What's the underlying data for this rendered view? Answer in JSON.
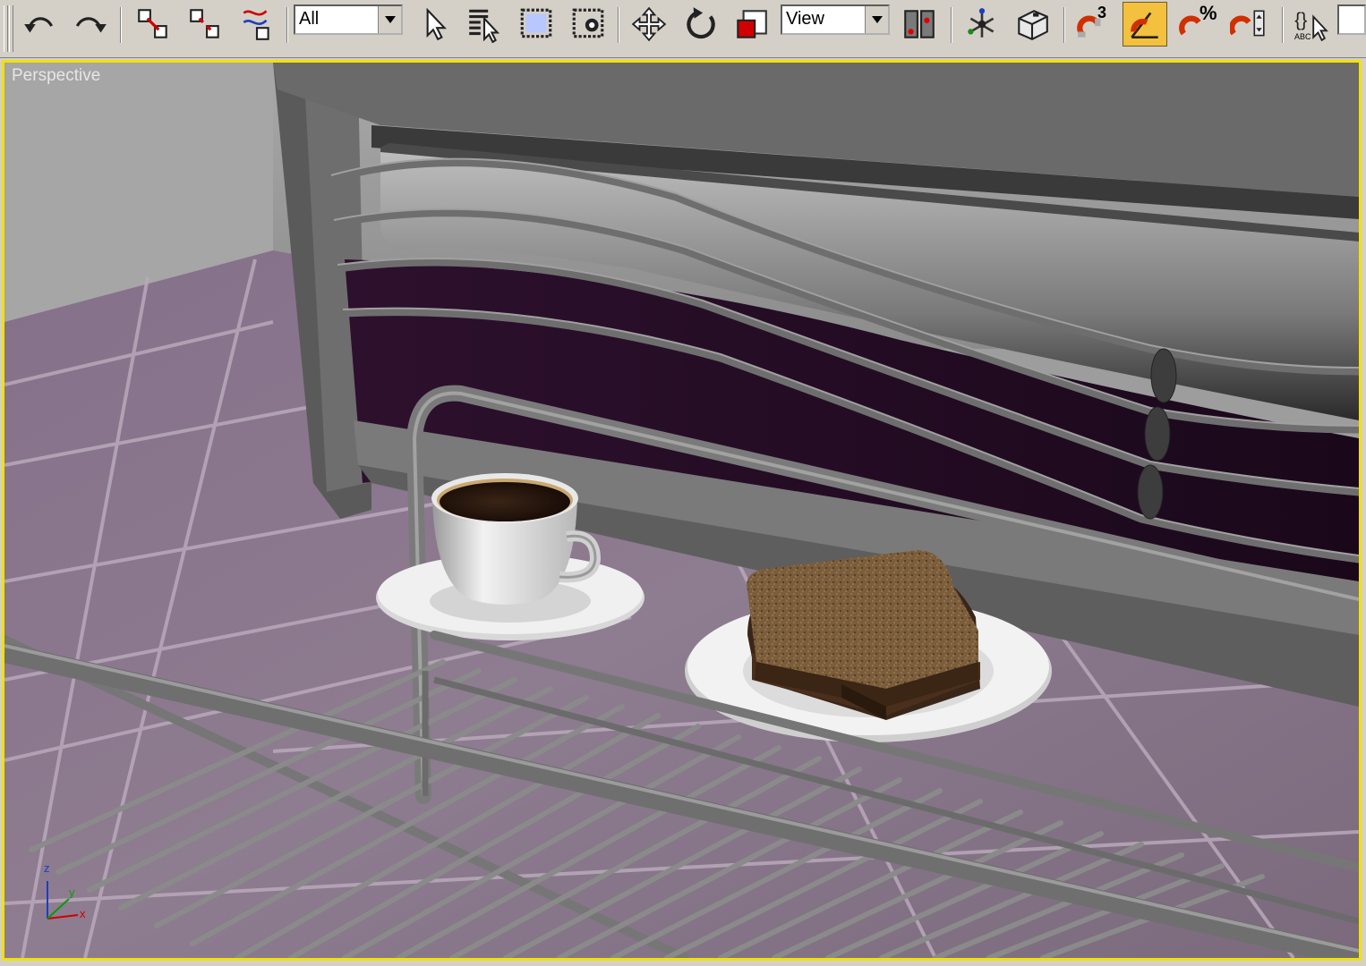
{
  "toolbar": {
    "selection_filter": {
      "value": "All"
    },
    "reference_coordinate": {
      "value": "View"
    },
    "snap_label": "3",
    "percent_snap_label": "%",
    "edit_named_sets_label": "ABC",
    "tools": [
      {
        "name": "undo-icon"
      },
      {
        "name": "redo-icon"
      },
      {
        "name": "select-and-link-icon"
      },
      {
        "name": "unlink-selection-icon"
      },
      {
        "name": "bind-to-space-warp-icon"
      },
      {
        "name": "select-object-icon"
      },
      {
        "name": "select-by-name-icon"
      },
      {
        "name": "rectangular-selection-icon"
      },
      {
        "name": "window-crossing-icon"
      },
      {
        "name": "select-and-move-icon"
      },
      {
        "name": "select-and-rotate-icon"
      },
      {
        "name": "select-and-scale-icon"
      },
      {
        "name": "use-pivot-center-icon"
      },
      {
        "name": "select-and-manipulate-icon"
      },
      {
        "name": "keyboard-shortcut-override-icon"
      },
      {
        "name": "snaps-toggle-icon"
      },
      {
        "name": "angle-snap-toggle-icon"
      },
      {
        "name": "percent-snap-toggle-icon"
      },
      {
        "name": "spinner-snap-toggle-icon"
      },
      {
        "name": "edit-named-selection-sets-icon"
      }
    ]
  },
  "viewport": {
    "label": "Perspective",
    "active_border_color": "#f2e200",
    "axis_tripod": {
      "z": "z",
      "y": "y",
      "x": "x"
    }
  },
  "colors": {
    "toolbar_bg": "#d4d0c8",
    "active_tool": "#f3c13e",
    "floor": "#8a7a8c",
    "headboard_purple": "#2a0f2a",
    "metal": "#7a7a7a"
  }
}
